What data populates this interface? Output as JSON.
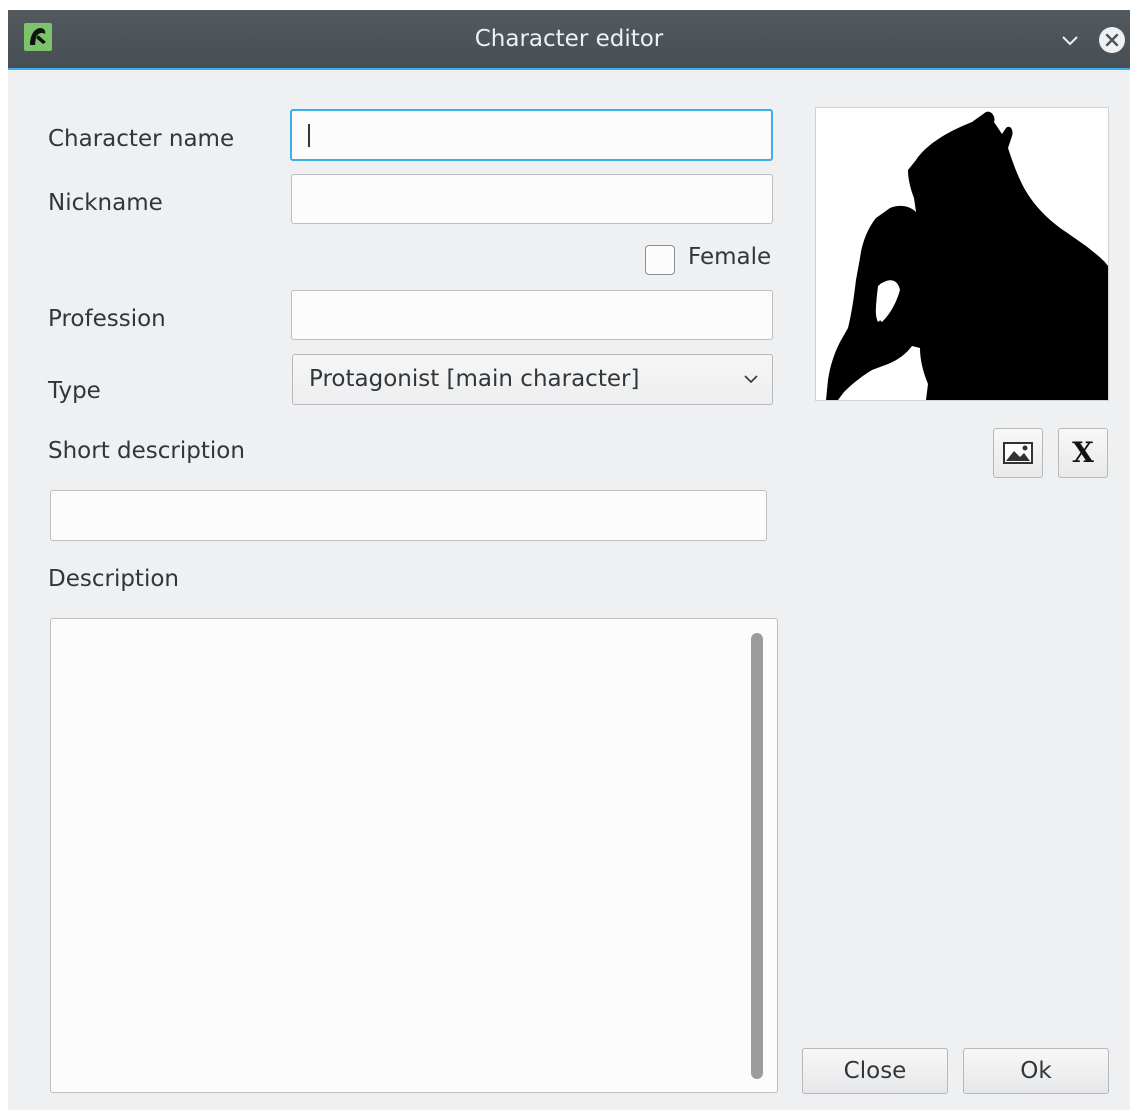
{
  "window": {
    "title": "Character editor"
  },
  "form": {
    "character_name_label": "Character name",
    "character_name_value": "",
    "nickname_label": "Nickname",
    "nickname_value": "",
    "female_label": "Female",
    "female_checked": false,
    "profession_label": "Profession",
    "profession_value": "",
    "type_label": "Type",
    "type_selected": "Protagonist [main character]",
    "short_description_label": "Short description",
    "short_description_value": "",
    "description_label": "Description",
    "description_value": ""
  },
  "portrait": {
    "image": "silhouette-of-man-in-hat",
    "load_button_icon": "image-icon",
    "clear_button_label": "X"
  },
  "buttons": {
    "close_label": "Close",
    "ok_label": "Ok"
  },
  "colors": {
    "accent": "#3daee9",
    "titlebar": "#4d555b",
    "window_bg": "#eff0f1"
  }
}
